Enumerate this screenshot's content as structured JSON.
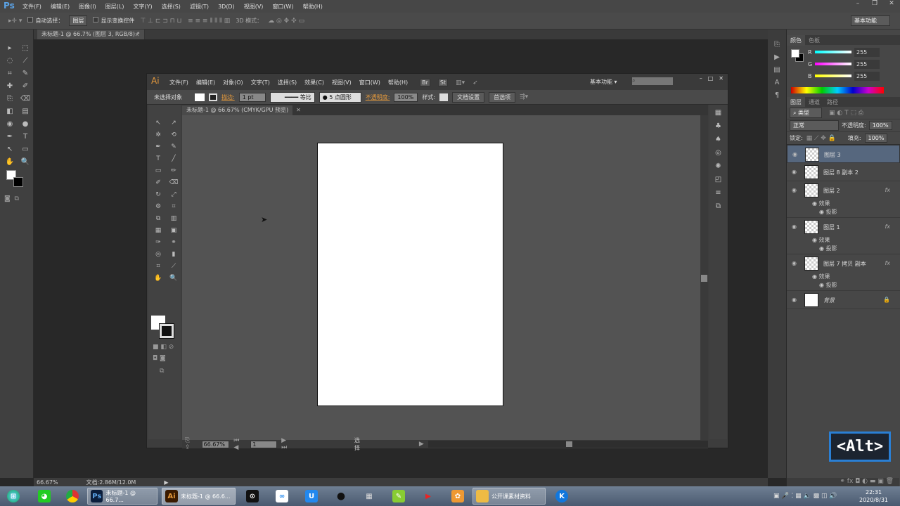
{
  "ps": {
    "logo": "Ps",
    "menu": [
      "文件(F)",
      "编辑(E)",
      "图像(I)",
      "图层(L)",
      "文字(Y)",
      "选择(S)",
      "滤镜(T)",
      "3D(D)",
      "视图(V)",
      "窗口(W)",
      "帮助(H)"
    ],
    "window_controls": [
      "–",
      "❐",
      "✕"
    ],
    "options": {
      "auto_select_label": "自动选择：",
      "auto_select_value": "图层",
      "show_transform_label": "显示变换控件",
      "mode_3d_label": "3D 模式：",
      "workspace": "基本功能"
    },
    "doc_tab": "未标题-1 @ 66.7% (图层 3, RGB/8) *",
    "tools": [
      "▸",
      "⬚",
      "◌",
      "⟋",
      "⌗",
      "✎",
      "✚",
      "✐",
      "⎘",
      "⌫",
      "◧",
      "▤",
      "◉",
      "●",
      "✒",
      "T",
      "↖",
      "▭",
      "✋",
      "🔍"
    ],
    "color_panel": {
      "tabs": [
        "颜色",
        "色板"
      ],
      "r": "255",
      "g": "255",
      "b": "255",
      "r_label": "R",
      "g_label": "G",
      "b_label": "B"
    },
    "layers_panel": {
      "tabs": [
        "图层",
        "通道",
        "路径"
      ],
      "filter": "类型",
      "blend_mode": "正常",
      "opacity_label": "不透明度:",
      "opacity": "100%",
      "lock_label": "锁定:",
      "fill_label": "填充:",
      "fill": "100%",
      "layers": [
        {
          "name": "图层 3",
          "selected": true
        },
        {
          "name": "图层 8 副本 2"
        },
        {
          "name": "图层 2",
          "fx": "fx",
          "effects_label": "效果",
          "effect": "投影"
        },
        {
          "name": "图层 1",
          "fx": "fx",
          "effects_label": "效果",
          "effect": "投影"
        },
        {
          "name": "图层 7 拷贝 副本",
          "fx": "fx",
          "effects_label": "效果",
          "effect": "投影"
        },
        {
          "name": "背景",
          "locked": true
        }
      ]
    },
    "status": {
      "zoom": "66.67%",
      "doc": "文档:2.86M/12.0M"
    }
  },
  "ai": {
    "logo": "Ai",
    "menu": [
      "文件(F)",
      "编辑(E)",
      "对象(O)",
      "文字(T)",
      "选择(S)",
      "效果(C)",
      "视图(V)",
      "窗口(W)",
      "帮助(H)"
    ],
    "app_buttons": [
      "Br",
      "St"
    ],
    "workspace": "基本功能",
    "window_controls": [
      "–",
      "□",
      "✕"
    ],
    "control": {
      "selection": "未选择对象",
      "stroke_label": "描边:",
      "stroke_value": "1 pt",
      "profile": "等比",
      "brush": "5 点圆形",
      "opacity_label": "不透明度:",
      "opacity": "100%",
      "style_label": "样式:",
      "doc_setup": "文档设置",
      "preferences": "首选项"
    },
    "doc_tab": "未标题-1 @ 66.67% (CMYK/GPU 预览)",
    "tools": [
      "↖",
      "↗",
      "✲",
      "⟲",
      "✒",
      "✎",
      "T",
      "╱",
      "▭",
      "✏",
      "✐",
      "⌫",
      "↻",
      "⤢",
      "⚙",
      "⌗",
      "⧉",
      "▥",
      "▦",
      "▣",
      "✑",
      "⚭",
      "◎",
      "▮",
      "⌗",
      "⟋",
      "✋",
      "🔍"
    ],
    "right_icons": [
      "▦",
      "♣",
      "♠",
      "◎",
      "✺",
      "◰",
      "≡",
      "⧉"
    ],
    "status": {
      "zoom": "66.67%",
      "page": "1",
      "tool": "选择"
    }
  },
  "taskbar": {
    "ps_task": "未标题-1 @ 66.7...",
    "ai_task": "未标题-1 @ 66.6...",
    "folder_task": "公开课素材资料",
    "time": "22:31",
    "date": "2020/8/31"
  },
  "overlay": {
    "key": "<Alt>"
  },
  "colors": {
    "ps_blue": "#5ba3e6",
    "ai_orange": "#e69a3c",
    "selected_layer": "#56677e",
    "alt_border": "#2a7fd4"
  }
}
